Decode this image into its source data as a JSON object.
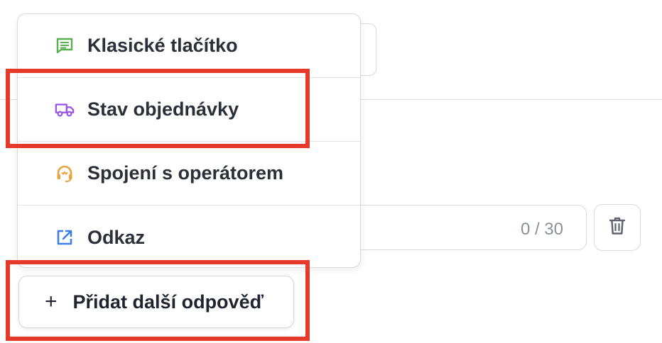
{
  "menu": {
    "items": [
      {
        "label": "Klasické tlačítko",
        "icon": "message-icon",
        "color": "#5aaf53"
      },
      {
        "label": "Stav objednávky",
        "icon": "truck-icon",
        "color": "#9b52e8"
      },
      {
        "label": "Spojení s operátorem",
        "icon": "headset-icon",
        "color": "#e8a33b"
      },
      {
        "label": "Odkaz",
        "icon": "external-link-icon",
        "color": "#3f7ee8"
      }
    ]
  },
  "answer_input": {
    "counter": "0 / 30"
  },
  "add_button": {
    "label": "Přidat další odpověď"
  },
  "highlight_color": "#e53a2a"
}
